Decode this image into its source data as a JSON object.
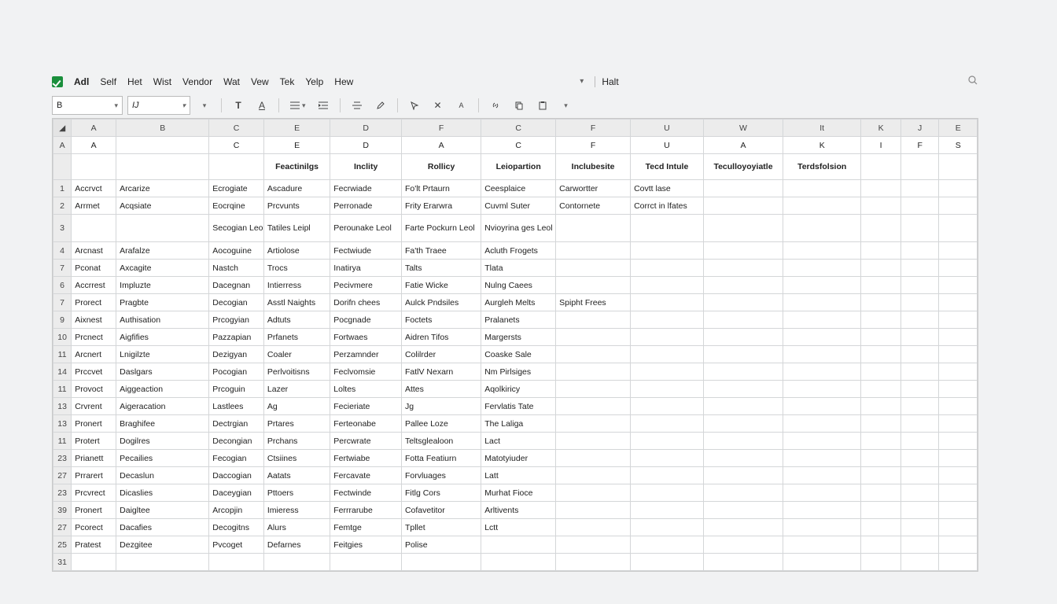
{
  "menubar": {
    "items": [
      "Adl",
      "Self",
      "Het",
      "Wist",
      "Vendor",
      "Wat",
      "Vew",
      "Tek",
      "Yelp",
      "Hew"
    ],
    "right_label": "Halt"
  },
  "toolbar": {
    "cell_ref": "B",
    "font_name": "IJ"
  },
  "column_headers": [
    "A",
    "B",
    "C",
    "E",
    "D",
    "F",
    "C",
    "F",
    "U",
    "W",
    "It",
    "K",
    "J",
    "E"
  ],
  "second_headers": [
    "A",
    "",
    "C",
    "E",
    "D",
    "A",
    "C",
    "F",
    "U",
    "A",
    "K",
    "I",
    "F",
    "S"
  ],
  "title_row": [
    "",
    "",
    "",
    "Feactinilgs",
    "Inclity",
    "Rollicy",
    "Leiopartion",
    "Inclubesite",
    "Tecd Intule",
    "Teculloyoyiatle",
    "Terdsfolsion",
    "",
    "",
    ""
  ],
  "row_labels": [
    "1",
    "2",
    "3",
    "4",
    "7",
    "6",
    "7",
    "9",
    "10",
    "11",
    "14",
    "11",
    "13",
    "13",
    "11",
    "23",
    "27",
    "23",
    "39",
    "27",
    "25",
    "31"
  ],
  "rows": [
    [
      "Accrvct",
      "Arcarize",
      "Ecrogiate",
      "Ascadure",
      "Fecrwiade",
      "Fo'lt Prtaurn",
      "Ceesplaice",
      "Carwortter",
      "Covtt lase",
      "",
      "",
      "",
      "",
      ""
    ],
    [
      "Arrmet",
      "Acqsiate",
      "Eocrqine",
      "Prcvunts",
      "Perronade",
      "Frity Erarwra",
      "Cuvml Suter",
      "Contornete",
      "Corrct in lfates",
      "",
      "",
      "",
      "",
      ""
    ],
    [
      "",
      "",
      "Secogian Leol",
      "Tatiles Leipl",
      "Perounake Leol",
      "Farte Pockurn Leol",
      "Nvioyrina ges Leol",
      "",
      "",
      "",
      "",
      "",
      "",
      ""
    ],
    [
      "Arcnast",
      "Arafalze",
      "Aocoguine",
      "Artiolose",
      "Fectwiude",
      "Fa'th Traee",
      "Acluth Frogets",
      "",
      "",
      "",
      "",
      "",
      "",
      ""
    ],
    [
      "Pconat",
      "Axcagite",
      "Nastch",
      "Trocs",
      "Inatirya",
      "Talts",
      "Tlata",
      "",
      "",
      "",
      "",
      "",
      "",
      ""
    ],
    [
      "Accrrest",
      "Impluzte",
      "Dacegnan",
      "Intierress",
      "Pecivmere",
      "Fatie Wicke",
      "Nulng Caees",
      "",
      "",
      "",
      "",
      "",
      "",
      ""
    ],
    [
      "Prorect",
      "Pragbte",
      "Decogian",
      "Asstl Naights",
      "Dorifn chees",
      "Aulck Pndsiles",
      "Aurgleh Melts",
      "Spipht Frees",
      "",
      "",
      "",
      "",
      "",
      ""
    ],
    [
      "Aixnest",
      "Authisation",
      "Prcogyian",
      "Adtuts",
      "Pocgnade",
      "Foctets",
      "Pralanets",
      "",
      "",
      "",
      "",
      "",
      "",
      ""
    ],
    [
      "Prcnect",
      "Aigfifies",
      "Pazzapian",
      "Prfanets",
      "Fortwaes",
      "Aidren Tifos",
      "Margersts",
      "",
      "",
      "",
      "",
      "",
      "",
      ""
    ],
    [
      "Arcnert",
      "Lnigilzte",
      "Dezigyan",
      "Coaler",
      "Perzamnder",
      "Colilrder",
      "Coaske Sale",
      "",
      "",
      "",
      "",
      "",
      "",
      ""
    ],
    [
      "Prccvet",
      "Daslgars",
      "Pocogian",
      "Perlvoitisns",
      "Feclvomsie",
      "FatlV Nexarn",
      "Nm Pirlsiges",
      "",
      "",
      "",
      "",
      "",
      "",
      ""
    ],
    [
      "Provoct",
      "Aiggeaction",
      "Prcoguin",
      "Lazer",
      "Loltes",
      "Attes",
      "Aqolkiricy",
      "",
      "",
      "",
      "",
      "",
      "",
      ""
    ],
    [
      "Crvrent",
      "Aigeracation",
      "Lastlees",
      "Ag",
      "Fecieriate",
      "Jg",
      "Fervlatis Tate",
      "",
      "",
      "",
      "",
      "",
      "",
      ""
    ],
    [
      "Pronert",
      "Braghifee",
      "Dectrgian",
      "Prtares",
      "Ferteonabe",
      "Pallee Loze",
      "The Laliga",
      "",
      "",
      "",
      "",
      "",
      "",
      ""
    ],
    [
      "Protert",
      "Dogilres",
      "Decongian",
      "Prchans",
      "Percwrate",
      "Teltsglealoon",
      "Lact",
      "",
      "",
      "",
      "",
      "",
      "",
      ""
    ],
    [
      "Prianett",
      "Pecailies",
      "Fecogian",
      "Ctsiines",
      "Fertwiabe",
      "Fotta Featiurn",
      "Matotyiuder",
      "",
      "",
      "",
      "",
      "",
      "",
      ""
    ],
    [
      "Prrarert",
      "Decaslun",
      "Daccogian",
      "Aatats",
      "Fercavate",
      "Forvluages",
      "Latt",
      "",
      "",
      "",
      "",
      "",
      "",
      ""
    ],
    [
      "Prcvrect",
      "Dicaslies",
      "Daceygian",
      "Pttoers",
      "Fectwinde",
      "Fitlg Cors",
      "Murhat Fioce",
      "",
      "",
      "",
      "",
      "",
      "",
      ""
    ],
    [
      "Pronert",
      "Daigltee",
      "Arcopjin",
      "Imieress",
      "Ferrrarube",
      "Cofavetitor",
      "Arltivents",
      "",
      "",
      "",
      "",
      "",
      "",
      ""
    ],
    [
      "Pcorect",
      "Dacafies",
      "Decogitns",
      "Alurs",
      "Femtge",
      "Tpllet",
      "Lctt",
      "",
      "",
      "",
      "",
      "",
      "",
      ""
    ],
    [
      "Pratest",
      "Dezgitee",
      "Pvcoget",
      "Defarnes",
      "Feitgies",
      "Polise",
      "",
      "",
      "",
      "",
      "",
      "",
      "",
      ""
    ],
    [
      "",
      "",
      "",
      "",
      "",
      "",
      "",
      "",
      "",
      "",
      "",
      "",
      "",
      ""
    ]
  ]
}
